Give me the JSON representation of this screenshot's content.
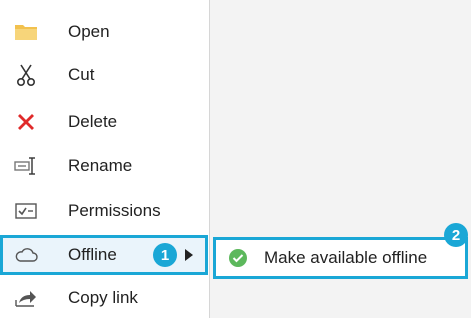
{
  "menu": {
    "items": [
      {
        "label": "Open",
        "icon": "folder-icon"
      },
      {
        "label": "Cut",
        "icon": "scissors-icon"
      },
      {
        "label": "Delete",
        "icon": "delete-x-icon"
      },
      {
        "label": "Rename",
        "icon": "rename-icon"
      },
      {
        "label": "Permissions",
        "icon": "permissions-icon"
      },
      {
        "label": "Offline",
        "icon": "cloud-icon"
      },
      {
        "label": "Copy link",
        "icon": "share-arrow-icon"
      }
    ]
  },
  "submenu": {
    "items": [
      {
        "label": "Make available offline",
        "icon": "check-circle-icon"
      }
    ]
  },
  "callouts": {
    "step1": "1",
    "step2": "2"
  },
  "colors": {
    "highlight": "#1aa7d6",
    "delete": "#e02a2a",
    "folder": "#f2c14e",
    "check": "#5cb85c"
  }
}
